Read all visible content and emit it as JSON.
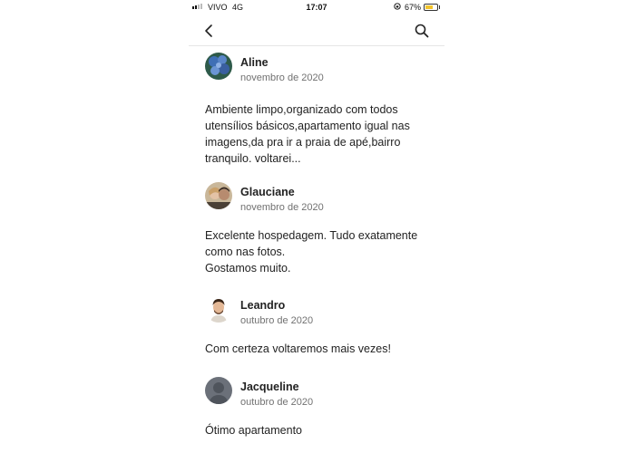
{
  "status_bar": {
    "carrier": "VIVO",
    "network": "4G",
    "time": "17:07",
    "battery": "67%",
    "battery_level": 0.67
  },
  "nav": {
    "back_icon": "chevron-left-icon",
    "search_icon": "search-icon"
  },
  "reviews": [
    {
      "name": "Aline",
      "date": "novembro de 2020",
      "text_lines": [
        "Ambiente limpo,organizado com todos",
        "utensílios básicos,apartamento igual nas",
        "imagens,da pra ir a praia de apé,bairro",
        "tranquilo. voltarei..."
      ]
    },
    {
      "name": "Glauciane",
      "date": "novembro de 2020",
      "text_lines": [
        "Excelente hospedagem. Tudo exatamente",
        "como nas fotos.",
        "Gostamos muito."
      ]
    },
    {
      "name": "Leandro",
      "date": "outubro de 2020",
      "text_lines": [
        "Com certeza voltaremos mais vezes!"
      ]
    },
    {
      "name": "Jacqueline",
      "date": "outubro de 2020",
      "text_lines": [
        "Ótimo apartamento"
      ]
    }
  ]
}
